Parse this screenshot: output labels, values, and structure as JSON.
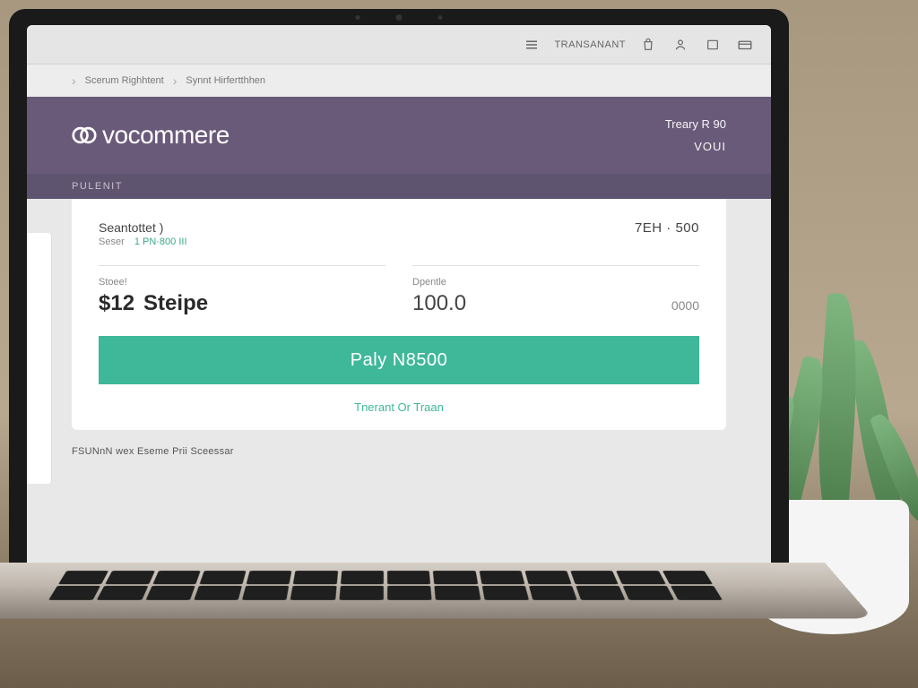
{
  "toolbar": {
    "label": "Transanant"
  },
  "breadcrumb": {
    "item1": "Scerum Righhtent",
    "item2": "Synnt Hirfertthhen"
  },
  "header": {
    "brand": "vocommere",
    "right_top": "Treary R 90",
    "right_bottom": "VOUI",
    "sub": "PULENIT"
  },
  "card": {
    "label_main": "Seantottet )",
    "label_sub": "Seser",
    "green_note": "1 PN·800 III",
    "right_value": "7EH · 500",
    "left_box": {
      "label": "Stoee!",
      "amount_prefix": "$12",
      "amount_main": "Steipe"
    },
    "right_box": {
      "label": "Dpentle",
      "amount": "100.0",
      "tail": "0000"
    }
  },
  "pay_button": "Paly N8500",
  "status_link": "Tnerant Or Traan",
  "footer_note": "FSUNnN wex Eseme Prii Sceessar"
}
